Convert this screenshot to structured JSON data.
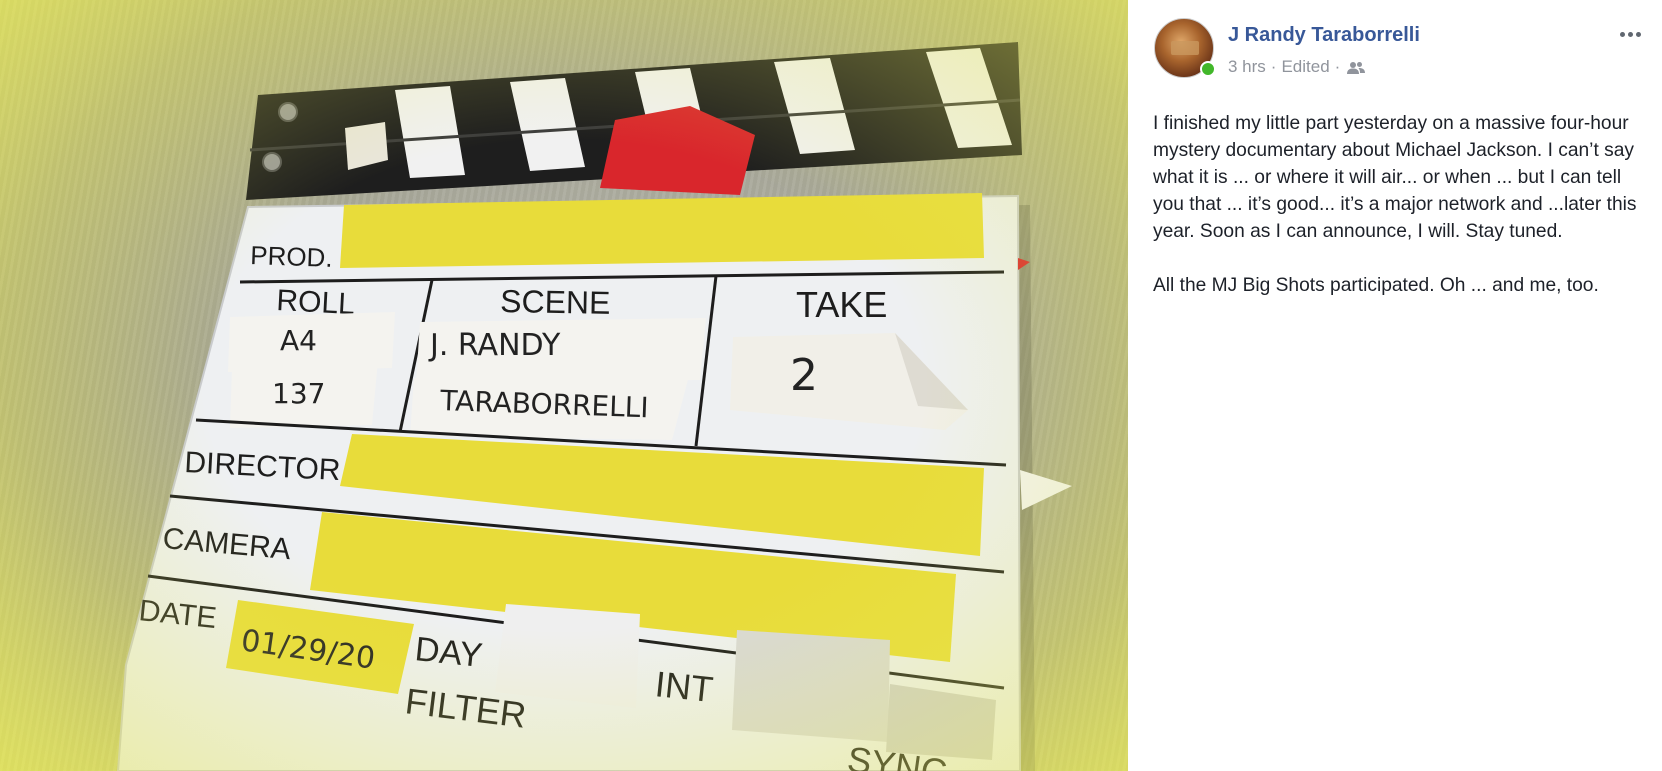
{
  "post": {
    "author_name": "J Randy Taraborrelli",
    "time": "3 hrs",
    "edited": "Edited",
    "separator": "·",
    "audience_icon": "friends-icon",
    "more_icon": "more-horizontal-icon",
    "paragraphs": [
      "I finished my little part yesterday on a massive four-hour mystery documentary about Michael Jackson. I can’t say what it is ... or where it will air... or when ... but I can tell you that ... it’s good... it’s a major network and ...later this year. Soon as I can announce, I will. Stay tuned.",
      "All the MJ Big Shots participated. Oh ... and me, too."
    ]
  },
  "clapper": {
    "prod_label": "PROD.",
    "roll_label": "ROLL",
    "scene_label": "SCENE",
    "take_label": "TAKE",
    "roll_line1": "A4",
    "roll_line2": "137",
    "scene_line1": "J. RANDY",
    "scene_line2": "TARABORRELLI",
    "take_value": "2",
    "director_label": "DIRECTOR",
    "camera_label": "CAMERA",
    "date_label": "DATE",
    "date_value": "01/29/20",
    "day_label": "DAY",
    "int_label": "INT",
    "filter_label": "FILTER",
    "sync_label": "SYNC",
    "accent_yellow": "#e8dc3a",
    "accent_red": "#d9262c"
  }
}
